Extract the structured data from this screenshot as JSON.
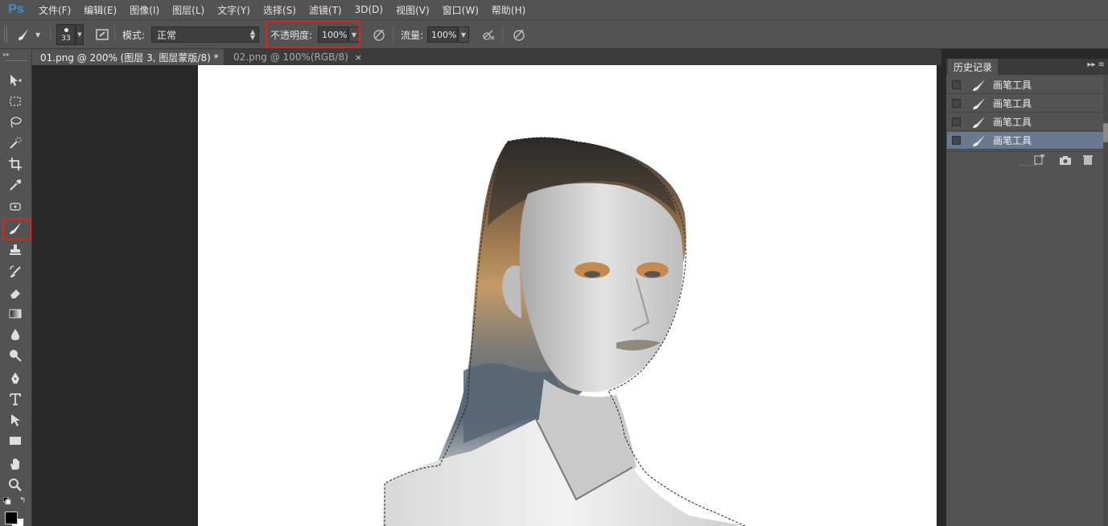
{
  "app": {
    "logo": "Ps"
  },
  "menu": [
    "文件(F)",
    "编辑(E)",
    "图像(I)",
    "图层(L)",
    "文字(Y)",
    "选择(S)",
    "滤镜(T)",
    "3D(D)",
    "视图(V)",
    "窗口(W)",
    "帮助(H)"
  ],
  "options": {
    "brush_size": "33",
    "mode_label": "模式:",
    "mode_value": "正常",
    "opacity_label": "不透明度:",
    "opacity_value": "100%",
    "flow_label": "流量:",
    "flow_value": "100%"
  },
  "tabs": [
    {
      "label": "01.png @ 200% (图层 3, 图层蒙版/8) *",
      "close": "×"
    },
    {
      "label": "02.png @ 100%(RGB/8)",
      "close": "×"
    }
  ],
  "history": {
    "title": "历史记录",
    "items": [
      {
        "label": "画笔工具"
      },
      {
        "label": "画笔工具"
      },
      {
        "label": "画笔工具"
      },
      {
        "label": "画笔工具"
      }
    ]
  },
  "colors": {
    "highlight": "#d8251f",
    "selected_row": "#697a90",
    "ui_bg": "#535353",
    "workspace": "#282828"
  },
  "icons": {
    "tools": [
      "move-icon",
      "marquee-icon",
      "lasso-icon",
      "quick-select-icon",
      "crop-icon",
      "eyedropper-icon",
      "healing-brush-icon",
      "brush-icon",
      "clone-stamp-icon",
      "history-brush-icon",
      "eraser-icon",
      "gradient-icon",
      "blur-icon",
      "dodge-icon",
      "pen-icon",
      "type-icon",
      "path-select-icon",
      "rectangle-icon",
      "hand-icon",
      "zoom-icon"
    ]
  }
}
